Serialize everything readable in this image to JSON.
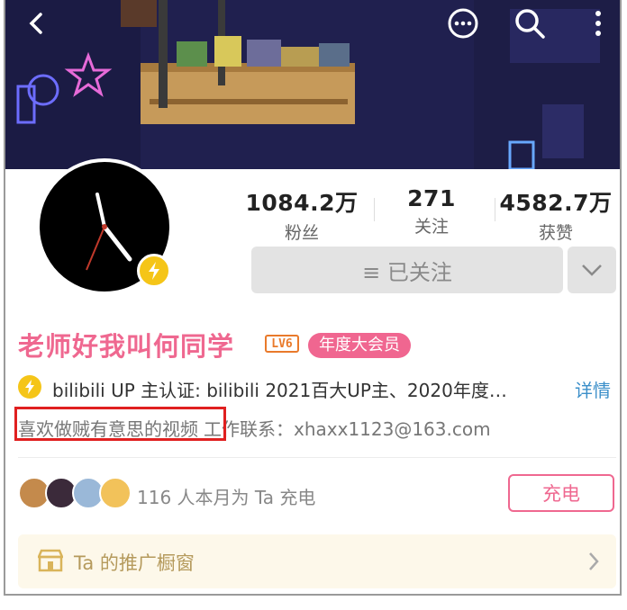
{
  "header": {
    "back_icon": "chevron-left-icon",
    "actions": [
      "chat-bubble-icon",
      "search-icon",
      "more-vertical-icon"
    ]
  },
  "profile": {
    "stats": [
      {
        "value": "1084.2万",
        "label": "粉丝"
      },
      {
        "value": "271",
        "label": "关注"
      },
      {
        "value": "4582.7万",
        "label": "获赞"
      }
    ],
    "follow_button_label": "≡ 已关注",
    "username": "老师好我叫何同学",
    "level": "LV6",
    "vip_label": "年度大会员",
    "verification": "bilibili UP 主认证: bilibili 2021百大UP主、2020年度…",
    "details_label": "详情",
    "bio": "喜欢做贼有意思的视频",
    "contact": "工作联系：xhaxx1123@163.com"
  },
  "charge": {
    "count_text": "116 人本月为 Ta 充电",
    "button_label": "充电"
  },
  "shop": {
    "label": "Ta 的推广橱窗"
  },
  "colors": {
    "accent_pink": "#ef6890",
    "link_blue": "#3b8fc9",
    "badge_yellow": "#f5c518",
    "highlight_red": "#e02020"
  }
}
